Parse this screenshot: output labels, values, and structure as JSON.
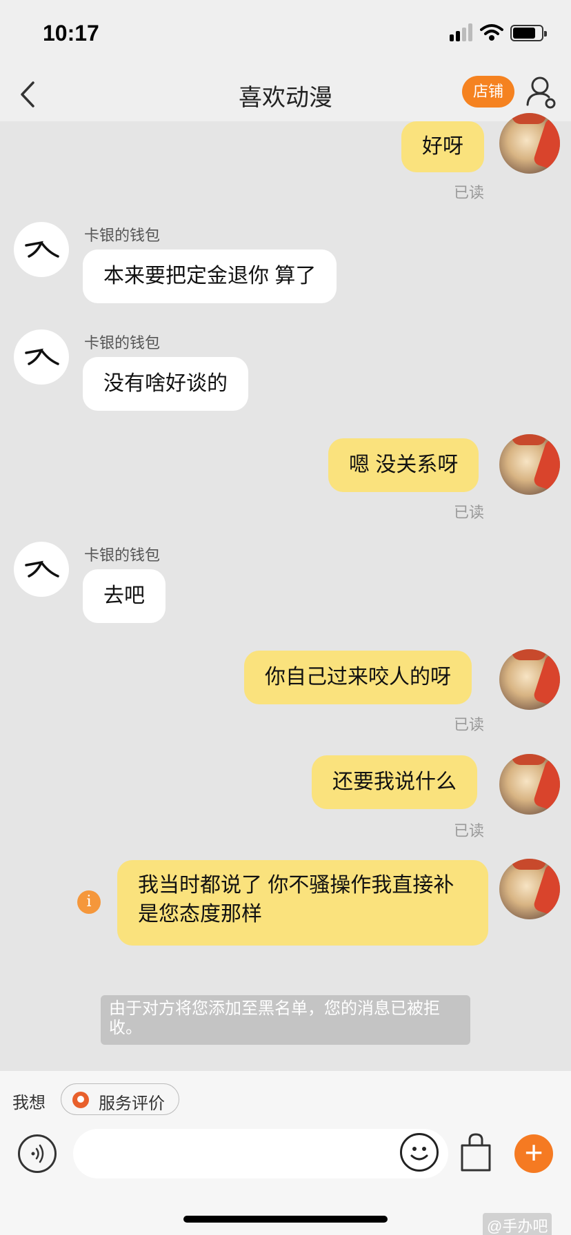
{
  "status": {
    "time": "10:17"
  },
  "nav": {
    "title": "喜欢动漫",
    "shop_label": "店铺"
  },
  "messages": [
    {
      "side": "me",
      "text": "好呀",
      "read": "已读"
    },
    {
      "side": "them",
      "sender": "卡银的钱包",
      "text": "本来要把定金退你 算了"
    },
    {
      "side": "them",
      "sender": "卡银的钱包",
      "text": "没有啥好谈的"
    },
    {
      "side": "me",
      "text": "嗯 没关系呀",
      "read": "已读"
    },
    {
      "side": "them",
      "sender": "卡银的钱包",
      "text": "去吧"
    },
    {
      "side": "me",
      "text": "你自己过来咬人的呀",
      "read": "已读"
    },
    {
      "side": "me",
      "text": "还要我说什么",
      "read": "已读"
    },
    {
      "side": "me",
      "text": "我当时都说了 你不骚操作我直接补 是您态度那样"
    }
  ],
  "notice": "由于对方将您添加至黑名单，您的消息已被拒收。",
  "bottom": {
    "wish_label": "我想",
    "service_label": "服务评价",
    "input_placeholder": "",
    "watermark": "@手办吧"
  },
  "colors": {
    "accent": "#f57a22",
    "my_bubble": "#fae27d",
    "their_bubble": "#ffffff"
  }
}
